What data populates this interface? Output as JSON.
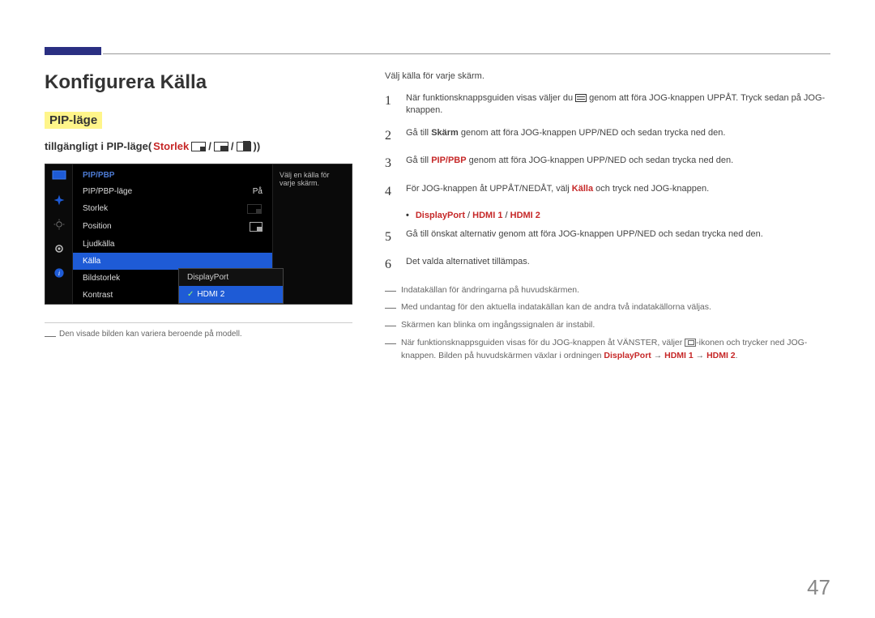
{
  "page_number": "47",
  "heading": "Konfigurera Källa",
  "pip_badge": "PIP-läge",
  "subtitle_prefix": "tillgängligt i PIP-läge(",
  "subtitle_storlek": "Storlek",
  "subtitle_close": "))",
  "osd": {
    "title": "PIP/PBP",
    "rows": [
      {
        "label": "PIP/PBP-läge",
        "value": "På"
      },
      {
        "label": "Storlek",
        "value": ""
      },
      {
        "label": "Position",
        "value": ""
      },
      {
        "label": "Ljudkälla",
        "value": ""
      },
      {
        "label": "Källa",
        "value": ""
      },
      {
        "label": "Bildstorlek",
        "value": ""
      },
      {
        "label": "Kontrast",
        "value": ""
      }
    ],
    "selected_index": 4,
    "submenu": [
      "DisplayPort",
      "HDMI 2"
    ],
    "submenu_selected": 1,
    "right_text": "Välj en källa för varje skärm."
  },
  "left_note": "Den visade bilden kan variera beroende på modell.",
  "intro": "Välj källa för varje skärm.",
  "steps": [
    {
      "n": "1",
      "pre": "När funktionsknappsguiden visas väljer du ",
      "post": " genom att föra JOG-knappen UPPÅT. Tryck sedan på JOG-knappen."
    },
    {
      "n": "2",
      "pre": "Gå till ",
      "bold": "Skärm",
      "post": " genom att föra JOG-knappen UPP/NED och sedan trycka ned den."
    },
    {
      "n": "3",
      "pre": "Gå till ",
      "red": "PIP/PBP",
      "post": " genom att föra JOG-knappen UPP/NED och sedan trycka ned den."
    },
    {
      "n": "4",
      "pre": "För JOG-knappen åt UPPÅT/NEDÅT, välj ",
      "red": "Källa",
      "post": " och tryck ned JOG-knappen."
    },
    {
      "n": "5",
      "pre": "Gå till önskat alternativ genom att föra JOG-knappen UPP/NED och sedan trycka ned den."
    },
    {
      "n": "6",
      "pre": "Det valda alternativet tillämpas."
    }
  ],
  "options_line": {
    "a": "DisplayPort",
    "b": "HDMI 1",
    "c": "HDMI 2",
    "sep": " / "
  },
  "dash_notes": [
    "Indatakällan för ändringarna på huvudskärmen.",
    "Med undantag för den aktuella indatakällan kan de andra två indatakällorna väljas.",
    "Skärmen kan blinka om ingångssignalen är instabil."
  ],
  "final_note": {
    "pre": "När funktionsknappsguiden visas för du JOG-knappen åt VÄNSTER, väljer ",
    "mid": "-ikonen och trycker ned JOG-knappen. Bilden på huvudskärmen växlar i ordningen ",
    "seq_a": "DisplayPort",
    "seq_b": "HDMI 1",
    "seq_c": "HDMI 2",
    "arrow": " → "
  }
}
